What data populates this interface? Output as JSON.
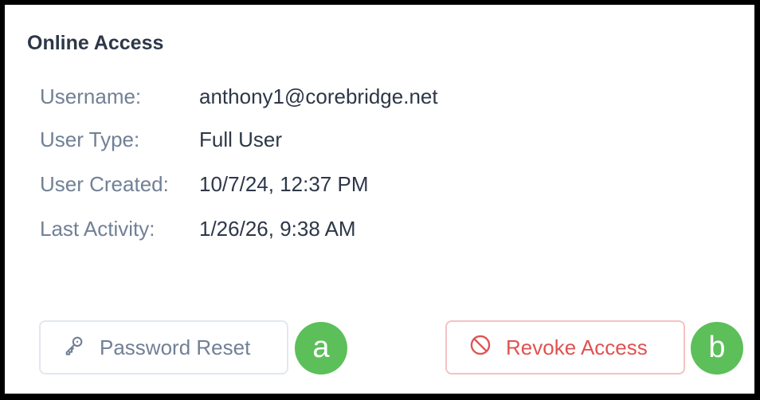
{
  "section": {
    "title": "Online Access"
  },
  "details": [
    {
      "label": "Username:",
      "value": "anthony1@corebridge.net"
    },
    {
      "label": "User Type:",
      "value": "Full User"
    },
    {
      "label": "User Created:",
      "value": "10/7/24, 12:37 PM"
    },
    {
      "label": "Last Activity:",
      "value": "1/26/26, 9:38 AM"
    }
  ],
  "actions": {
    "password_reset": {
      "label": "Password Reset",
      "icon": "key-icon"
    },
    "revoke_access": {
      "label": "Revoke Access",
      "icon": "ban-icon"
    }
  },
  "annotations": {
    "a": "a",
    "b": "b"
  },
  "colors": {
    "title_text": "#2d3748",
    "label_text": "#718096",
    "danger": "#e05252",
    "danger_border": "#f5c2c2",
    "annotation_badge": "#5cbf5a"
  }
}
